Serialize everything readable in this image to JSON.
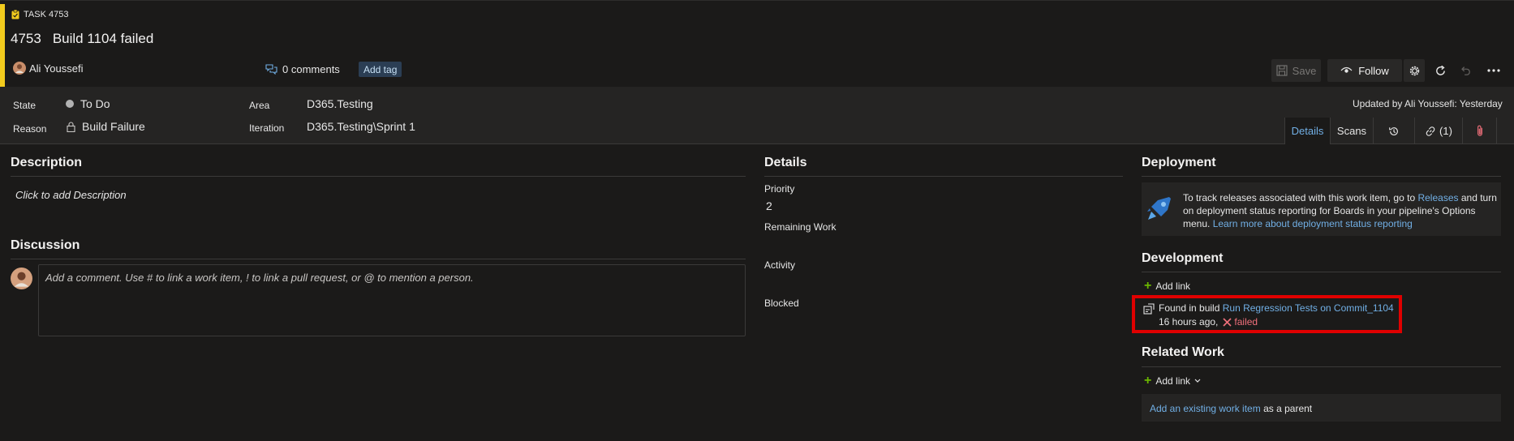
{
  "header": {
    "type_label": "TASK 4753",
    "id": "4753",
    "title": "Build 1104 failed",
    "assignee": "Ali Youssefi",
    "comments": "0 comments",
    "add_tag": "Add tag",
    "save": "Save",
    "follow": "Follow",
    "updated": "Updated by Ali Youssefi: Yesterday"
  },
  "fields": {
    "state_label": "State",
    "state_value": "To Do",
    "reason_label": "Reason",
    "reason_value": "Build Failure",
    "area_label": "Area",
    "area_value": "D365.Testing",
    "iteration_label": "Iteration",
    "iteration_value": "D365.Testing\\Sprint 1"
  },
  "tabs": {
    "details": "Details",
    "scans": "Scans",
    "links_count": "(1)"
  },
  "description": {
    "title": "Description",
    "placeholder": "Click to add Description"
  },
  "discussion": {
    "title": "Discussion",
    "placeholder": "Add a comment. Use # to link a work item, ! to link a pull request, or @ to mention a person."
  },
  "details": {
    "title": "Details",
    "priority_label": "Priority",
    "priority_value": "2",
    "remaining_label": "Remaining Work",
    "activity_label": "Activity",
    "blocked_label": "Blocked"
  },
  "deployment": {
    "title": "Deployment",
    "text1": "To track releases associated with this work item, go to",
    "releases_link": "Releases",
    "text2": "and turn",
    "text3": "on deployment status reporting for Boards in your pipeline's Options",
    "text4": "menu.",
    "learn_link": "Learn more about deployment status reporting"
  },
  "development": {
    "title": "Development",
    "add_link": "Add link",
    "found_in": "Found in build",
    "build_link": "Run Regression Tests on Commit_1104",
    "time": "16 hours ago,",
    "status": "failed"
  },
  "related": {
    "title": "Related Work",
    "add_link": "Add link",
    "existing_link": "Add an existing work item",
    "as_parent": "as a parent"
  },
  "colors": {
    "accent": "#f2cb1d",
    "link": "#71afe5",
    "failed": "#f1707b",
    "highlight": "#e00000"
  }
}
